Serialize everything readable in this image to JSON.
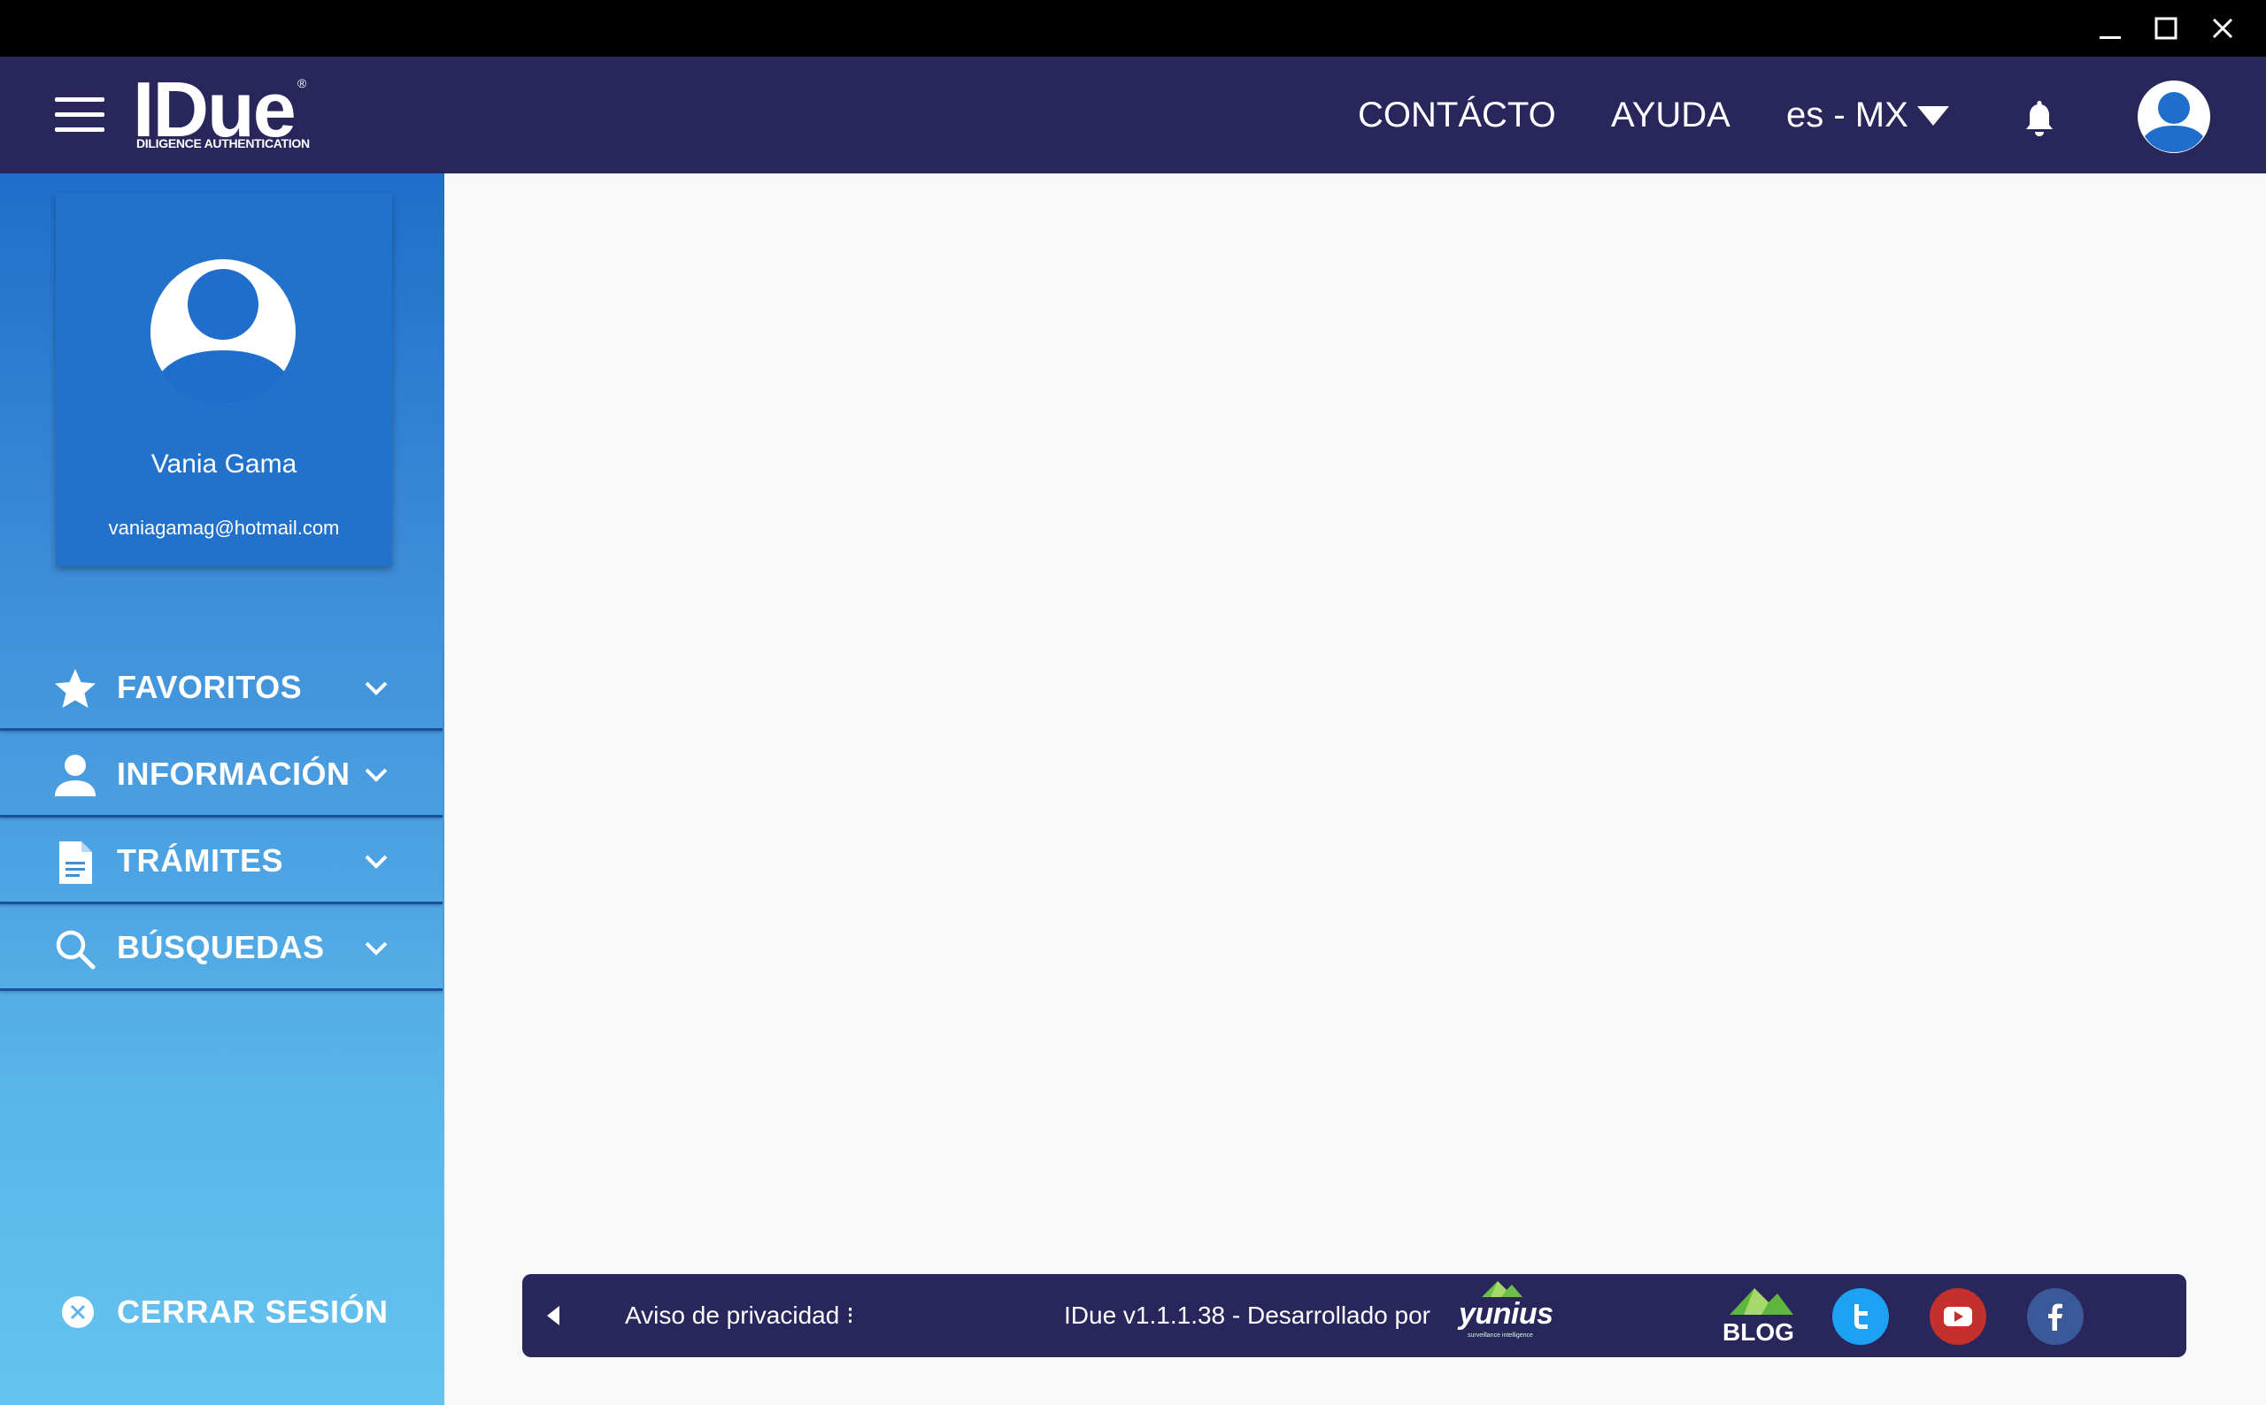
{
  "window": {
    "minimize_icon": "minimize-icon",
    "maximize_icon": "maximize-icon",
    "close_icon": "close-icon"
  },
  "header": {
    "logo_text": "IDue",
    "logo_subtitle": "DILIGENCE AUTHENTICATION",
    "logo_registered": "®",
    "nav": {
      "contact": "CONTÁCTO",
      "help": "AYUDA"
    },
    "language": "es - MX",
    "colors": {
      "background": "#29265c"
    }
  },
  "sidebar": {
    "profile": {
      "name": "Vania Gama",
      "email": "vaniagamag@hotmail.com"
    },
    "menu": [
      {
        "label": "FAVORITOS",
        "icon": "star-icon"
      },
      {
        "label": "INFORMACIÓN",
        "icon": "person-icon"
      },
      {
        "label": "TRÁMITES",
        "icon": "document-icon"
      },
      {
        "label": "BÚSQUEDAS",
        "icon": "search-icon"
      }
    ],
    "logout_label": "CERRAR SESIÓN"
  },
  "footer": {
    "privacy": "Aviso de privacidad ⁝",
    "version_text": "IDue v1.1.1.38 - Desarrollado por",
    "brand": "yunius",
    "brand_tagline": "surveillance intelligence",
    "blog": "BLOG",
    "social": [
      "twitter-icon",
      "youtube-icon",
      "facebook-icon"
    ],
    "colors": {
      "twitter": "#1da1f2",
      "youtube": "#c4302b",
      "facebook": "#3b5998"
    }
  }
}
